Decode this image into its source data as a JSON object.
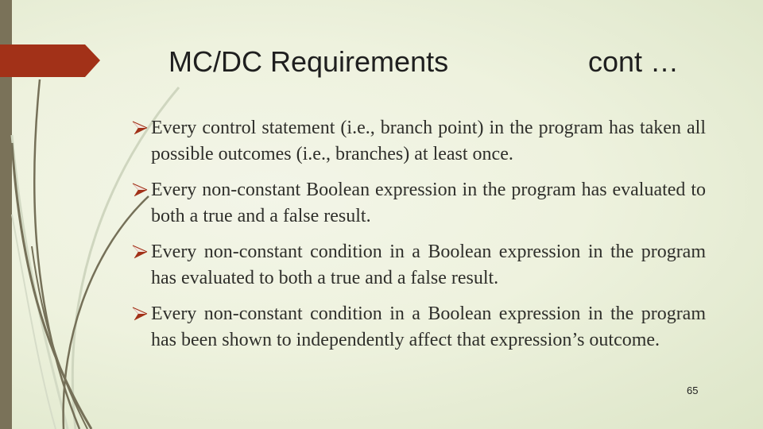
{
  "slide": {
    "title": "MC/DC Requirements",
    "title_suffix": "cont …",
    "bullets": [
      {
        "icon": "arrowhead-bullet-icon",
        "text": "Every control statement (i.e., branch point) in the program has taken all possible outcomes (i.e., branches) at least once."
      },
      {
        "icon": "arrowhead-bullet-icon",
        "text": "Every non-constant Boolean expression in the program has evaluated to both a true and a false result."
      },
      {
        "icon": "arrowhead-bullet-icon",
        "text": "Every non-constant condition in a Boolean expression in the program has evaluated to both a true and a false result."
      },
      {
        "icon": "arrowhead-bullet-icon",
        "text": "Every non-constant condition in a Boolean expression in the program has been shown to independently affect that expression’s outcome."
      }
    ],
    "page_number": "65"
  },
  "theme": {
    "accent": "#a23118",
    "bar": "#7a7259",
    "text": "#2f2f2b",
    "background": "#eef2de"
  }
}
